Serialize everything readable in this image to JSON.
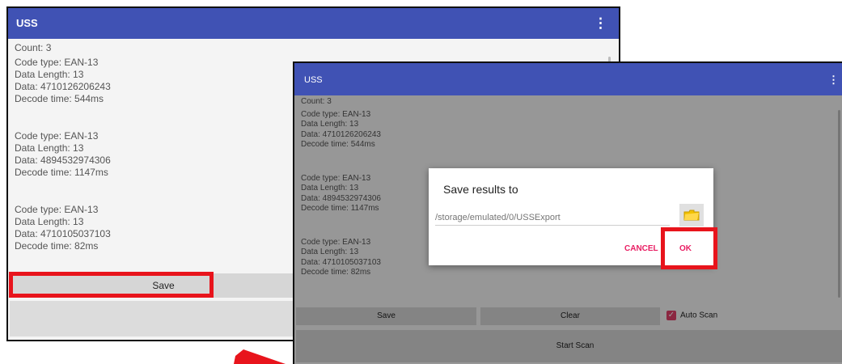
{
  "app_title": "USS",
  "menu_icon": "⋮",
  "count_label": "Count:  3",
  "records": [
    {
      "code_type": "Code type: EAN-13",
      "data_length": "Data Length: 13",
      "data": "Data: 4710126206243",
      "decode_time": "Decode time: 544ms"
    },
    {
      "code_type": "Code type: EAN-13",
      "data_length": "Data Length: 13",
      "data": "Data: 4894532974306",
      "decode_time": "Decode time: 1147ms"
    },
    {
      "code_type": "Code type: EAN-13",
      "data_length": "Data Length: 13",
      "data": "Data: 4710105037103",
      "decode_time": "Decode time: 82ms"
    }
  ],
  "buttons": {
    "save": "Save",
    "clear": "Clear",
    "start_scan": "Start Scan",
    "auto_scan": "Auto Scan",
    "auto_scan_checked": true
  },
  "dialog": {
    "title": "Save results to",
    "path_placeholder": "/storage/emulated/0/USSExport",
    "cancel": "CANCEL",
    "ok": "OK"
  },
  "colors": {
    "app_bar": "#4052b4",
    "accent": "#e91e63",
    "highlight": "#e8141c",
    "checkbox": "#e0406a"
  },
  "icons": {
    "folder": "folder-icon",
    "menu": "more-vert-icon",
    "arrow": "arrow-icon"
  }
}
